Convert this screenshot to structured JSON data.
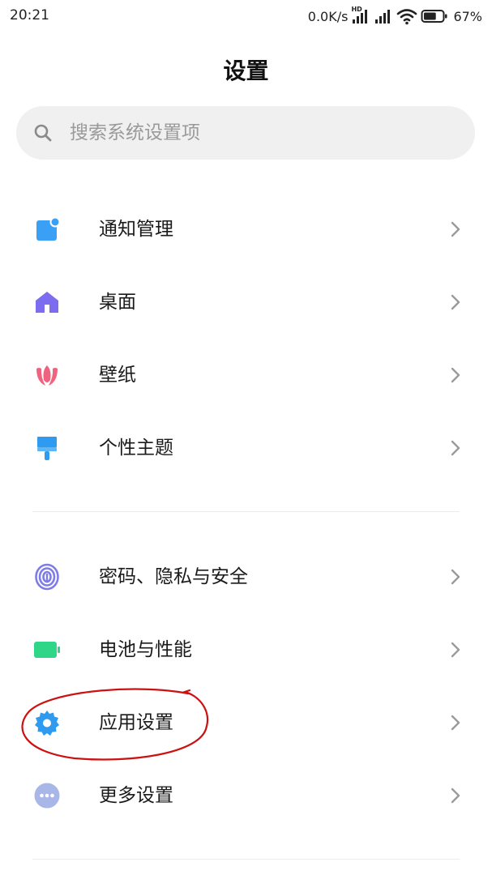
{
  "status_bar": {
    "time": "20:21",
    "network_speed": "0.0K/s",
    "hd_label": "HD",
    "battery_percent": "67%",
    "battery_level": 0.67
  },
  "header": {
    "title": "设置"
  },
  "search": {
    "placeholder": "搜索系统设置项",
    "value": ""
  },
  "menu": {
    "items": [
      {
        "label": "通知管理",
        "icon": "notification-icon",
        "color": "#3aa0f5"
      },
      {
        "label": "桌面",
        "icon": "home-icon",
        "color": "#7b6cf0"
      },
      {
        "label": "壁纸",
        "icon": "tulip-icon",
        "color": "#f0637e"
      },
      {
        "label": "个性主题",
        "icon": "brush-icon",
        "color": "#2f9bf0"
      },
      {
        "label": "密码、隐私与安全",
        "icon": "fingerprint-icon",
        "color": "#7e7ce8"
      },
      {
        "label": "电池与性能",
        "icon": "battery-icon",
        "color": "#2fd688"
      },
      {
        "label": "应用设置",
        "icon": "gear-icon",
        "color": "#2f9bf0"
      },
      {
        "label": "更多设置",
        "icon": "more-icon",
        "color": "#a9b6e8"
      }
    ]
  },
  "annotation": {
    "color": "#cc1111"
  }
}
